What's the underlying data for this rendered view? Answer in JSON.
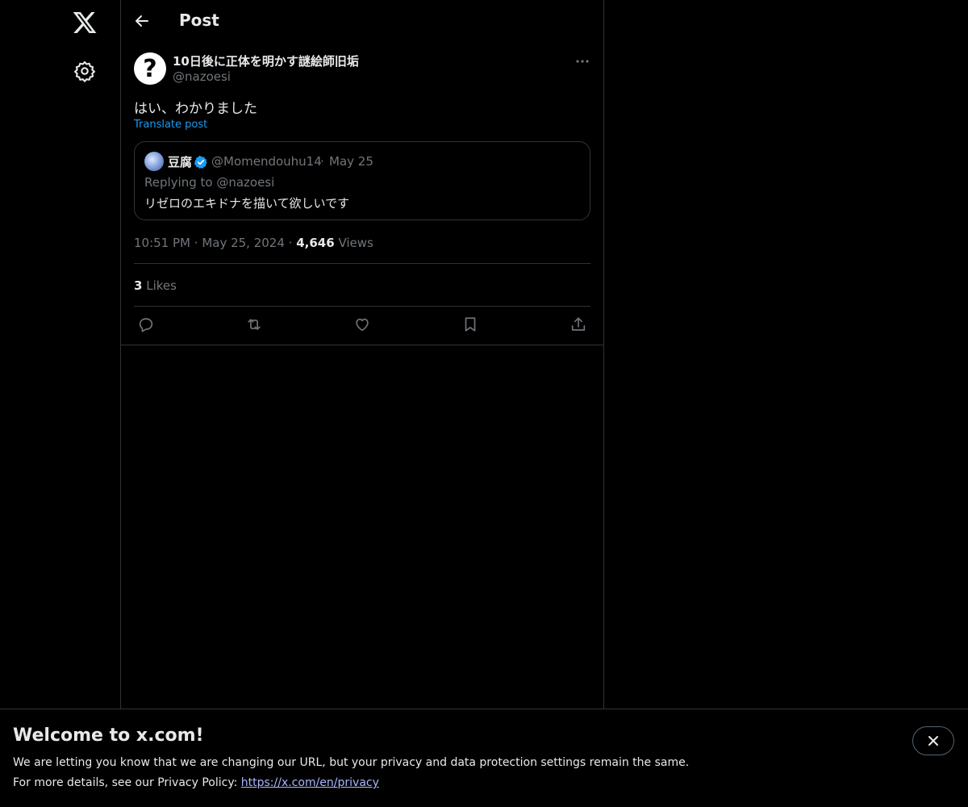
{
  "header": {
    "title": "Post"
  },
  "post": {
    "avatar_glyph": "?",
    "display_name": "10日後に正体を明かす謎絵師旧垢",
    "handle": "@nazoesi",
    "text": "はい、わかりました",
    "translate_label": "Translate post",
    "quote": {
      "name": "豆腐",
      "handle": "@Momendouhu14",
      "separator": "·",
      "date": "May 25",
      "replying_to": "Replying to @nazoesi",
      "text": "リゼロのエキドナを描いて欲しいです"
    },
    "time": "10:51 PM",
    "date": "May 25, 2024",
    "views_count": "4,646",
    "views_label": "Views",
    "likes_count": "3",
    "likes_label": "Likes"
  },
  "banner": {
    "title": "Welcome to x.com!",
    "line1": "We are letting you know that we are changing our URL, but your privacy and data protection settings remain the same.",
    "line2_prefix": "For more details, see our Privacy Policy:",
    "link_text": "https://x.com/en/privacy"
  },
  "icons": {
    "nav": [
      "x-logo-icon",
      "settings-gear-icon"
    ],
    "actions": [
      "reply-icon",
      "repost-icon",
      "like-icon",
      "bookmark-icon",
      "share-icon"
    ]
  },
  "colors": {
    "background": "#000000",
    "text": "#e7e9ea",
    "muted": "#71767b",
    "accent": "#1d9bf0",
    "border": "#2f3336"
  }
}
